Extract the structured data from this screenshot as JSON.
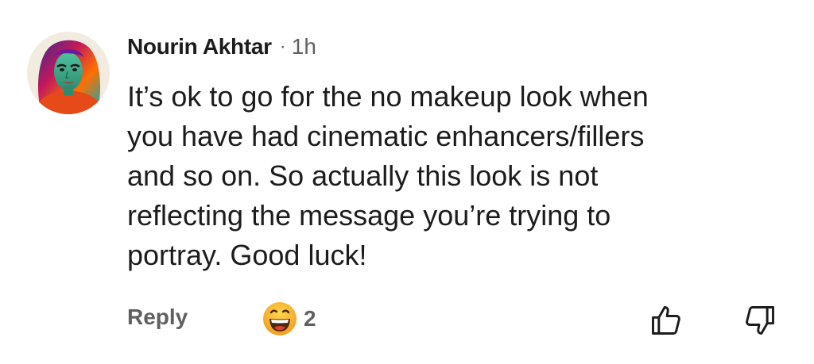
{
  "comment": {
    "author": "Nourin Akhtar",
    "separator": "·",
    "time": "1h",
    "lines": [
      "It’s ok to go for the no makeup look when",
      "you have had cinematic enhancers/fillers",
      "and so on. So actually this look is not",
      "reflecting the message you’re trying to",
      "portray. Good luck!"
    ]
  },
  "actions": {
    "reply_label": "Reply",
    "reaction_icon": "grinning-emoji-icon",
    "reaction_count": "2",
    "like_icon": "thumbs-up-icon",
    "dislike_icon": "thumbs-down-icon"
  },
  "colors": {
    "text": "#1c1c1c",
    "muted": "#606060",
    "emoji": "#f7b733"
  }
}
